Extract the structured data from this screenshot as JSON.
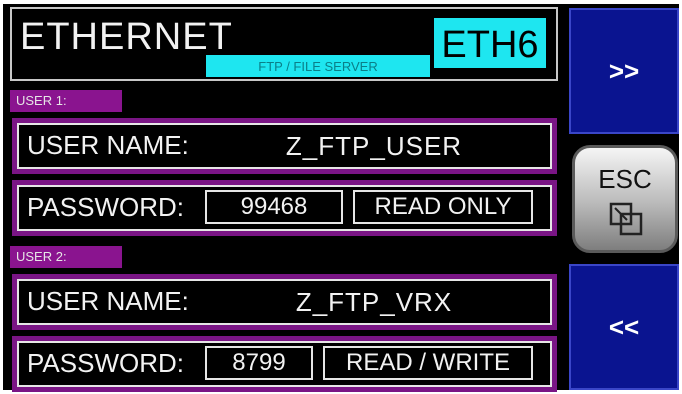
{
  "header": {
    "title": "ETHERNET",
    "subtitle": "FTP / FILE SERVER",
    "badge": "ETH6",
    "badge_color": "#1ee6f0"
  },
  "users": [
    {
      "tag": "USER 1:",
      "username_label": "USER NAME:",
      "username": "Z_FTP_USER",
      "password_label": "PASSWORD:",
      "password": "99468",
      "access": "READ ONLY"
    },
    {
      "tag": "USER 2:",
      "username_label": "USER NAME:",
      "username": "Z_FTP_VRX",
      "password_label": "PASSWORD:",
      "password": "8799",
      "access": "READ / WRITE"
    }
  ],
  "nav": {
    "next_label": ">>",
    "esc_label": "ESC",
    "esc_icon": "overlapping-squares-icon",
    "prev_label": "<<"
  },
  "colors": {
    "row_purple": "#7a1585",
    "tag_purple": "#8a148f",
    "nav_blue": "#0a1490"
  }
}
